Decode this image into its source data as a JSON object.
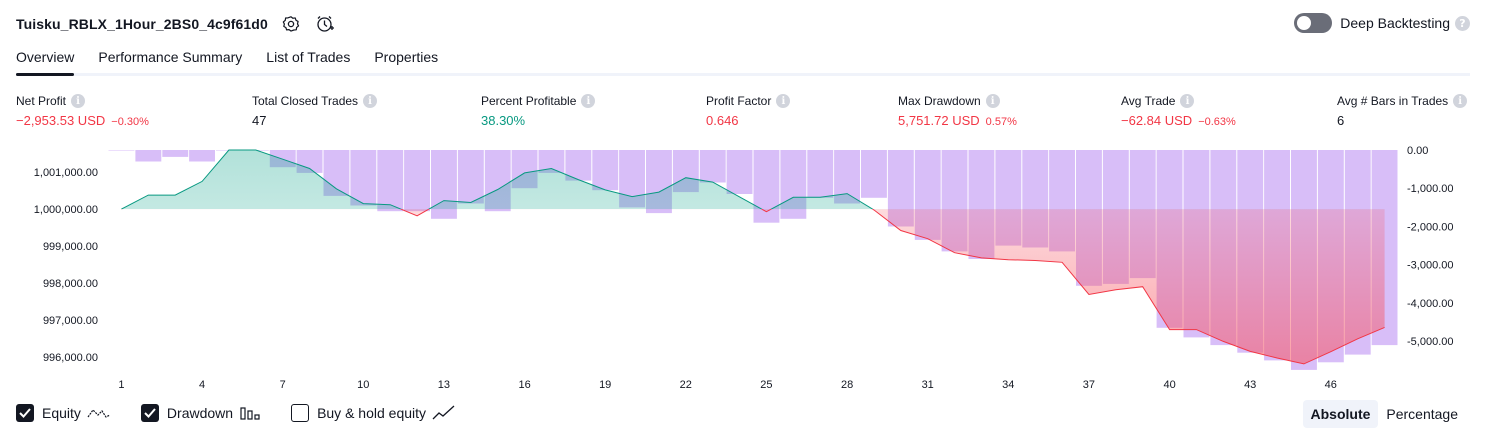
{
  "header": {
    "title": "Tuisku_RBLX_1Hour_2BS0_4c9f61d0",
    "deep_backtesting_label": "Deep Backtesting",
    "help_glyph": "?"
  },
  "tabs": [
    {
      "label": "Overview",
      "active": true
    },
    {
      "label": "Performance Summary",
      "active": false
    },
    {
      "label": "List of Trades",
      "active": false
    },
    {
      "label": "Properties",
      "active": false
    }
  ],
  "info_glyph": "i",
  "stats": {
    "net_profit": {
      "label": "Net Profit",
      "value": "−2,953.53 USD",
      "sub": "−0.30%"
    },
    "total_closed_trades": {
      "label": "Total Closed Trades",
      "value": "47"
    },
    "percent_profitable": {
      "label": "Percent Profitable",
      "value": "38.30%"
    },
    "profit_factor": {
      "label": "Profit Factor",
      "value": "0.646"
    },
    "max_drawdown": {
      "label": "Max Drawdown",
      "value": "5,751.72 USD",
      "sub": "0.57%"
    },
    "avg_trade": {
      "label": "Avg Trade",
      "value": "−62.84 USD",
      "sub": "−0.63%"
    },
    "avg_bars": {
      "label": "Avg # Bars in Trades",
      "value": "6"
    }
  },
  "colors": {
    "positive": "#089981",
    "negative": "#f23645",
    "equity_up_line": "#089981",
    "equity_down_line": "#f23645",
    "drawdown_bar": "#d1b3f7"
  },
  "chart_data": {
    "type": "area",
    "x_tick_labels": [
      "1",
      "4",
      "7",
      "10",
      "13",
      "16",
      "19",
      "22",
      "25",
      "28",
      "31",
      "34",
      "37",
      "40",
      "43",
      "46"
    ],
    "left_axis": {
      "ticks": [
        1001000,
        1000000,
        999000,
        998000,
        997000,
        996000
      ],
      "tick_labels": [
        "1,001,000.00",
        "1,000,000.00",
        "999,000.00",
        "998,000.00",
        "997,000.00",
        "996,000.00"
      ],
      "ylim": [
        995700,
        1001600
      ]
    },
    "right_axis": {
      "ticks": [
        0,
        -1000,
        -2000,
        -3000,
        -4000,
        -5000
      ],
      "tick_labels": [
        "0.00",
        "-1,000.00",
        "-2,000.00",
        "-3,000.00",
        "-4,000.00",
        "-5,000.00"
      ],
      "ylim": [
        -5700,
        0
      ]
    },
    "baseline": 1000000,
    "equity": {
      "x": [
        1,
        2,
        3,
        4,
        5,
        6,
        7,
        8,
        9,
        10,
        11,
        12,
        13,
        14,
        15,
        16,
        17,
        18,
        19,
        20,
        21,
        22,
        23,
        24,
        25,
        26,
        27,
        28,
        29,
        30,
        31,
        32,
        33,
        34,
        35,
        36,
        37,
        38,
        39,
        40,
        41,
        42,
        43,
        44,
        45,
        46,
        47,
        48
      ],
      "values": [
        1000000,
        1000380,
        1000380,
        1000750,
        1001600,
        1001600,
        1001350,
        1001100,
        1000550,
        1000150,
        1000120,
        999820,
        1000230,
        1000180,
        1000530,
        1000980,
        1001100,
        1000800,
        1000520,
        1000340,
        1000460,
        1000850,
        1000730,
        1000330,
        999930,
        1000320,
        1000320,
        1000420,
        999980,
        999420,
        999200,
        998820,
        998680,
        998630,
        998610,
        998560,
        997690,
        997820,
        997900,
        996740,
        996740,
        996420,
        996150,
        995970,
        995810,
        996140,
        996490,
        996800
      ]
    },
    "drawdown": {
      "x": [
        1,
        2,
        3,
        4,
        5,
        6,
        7,
        8,
        9,
        10,
        11,
        12,
        13,
        14,
        15,
        16,
        17,
        18,
        19,
        20,
        21,
        22,
        23,
        24,
        25,
        26,
        27,
        28,
        29,
        30,
        31,
        32,
        33,
        34,
        35,
        36,
        37,
        38,
        39,
        40,
        41,
        42,
        43,
        44,
        45,
        46,
        47,
        48
      ],
      "values": [
        0,
        -300,
        -180,
        -300,
        0,
        0,
        -450,
        -600,
        -1200,
        -1450,
        -1600,
        -1600,
        -1800,
        -1400,
        -1600,
        -1000,
        -600,
        -800,
        -1050,
        -1500,
        -1650,
        -1100,
        -850,
        -1150,
        -1900,
        -1800,
        -1250,
        -1400,
        -1250,
        -2000,
        -2350,
        -2650,
        -2850,
        -2500,
        -2550,
        -2650,
        -3550,
        -3500,
        -3350,
        -4650,
        -4900,
        -5100,
        -5300,
        -5500,
        -5750,
        -5550,
        -5350,
        -5100
      ]
    },
    "legend": [
      "Equity",
      "Drawdown",
      "Buy & hold equity"
    ],
    "legend_checked": [
      true,
      true,
      false
    ],
    "grid": false
  },
  "modes": [
    {
      "label": "Absolute",
      "active": true
    },
    {
      "label": "Percentage",
      "active": false
    }
  ]
}
